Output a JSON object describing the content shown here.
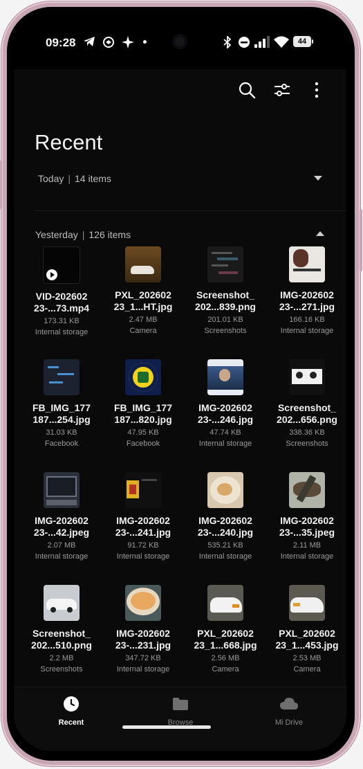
{
  "status_bar": {
    "time": "09:28",
    "battery": "44"
  },
  "header": {
    "title": "Recent"
  },
  "groups": {
    "today": {
      "label": "Today",
      "count": "14 items"
    },
    "yesterday": {
      "label": "Yesterday",
      "count": "126 items"
    }
  },
  "files": [
    {
      "name": "VID-202602\n23-...73.mp4",
      "size": "173.31 KB",
      "location": "Internal storage"
    },
    {
      "name": "PXL_202602\n23_1...HT.jpg",
      "size": "2.47 MB",
      "location": "Camera"
    },
    {
      "name": "Screenshot_\n202...839.png",
      "size": "201.01 KB",
      "location": "Screenshots"
    },
    {
      "name": "IMG-202602\n23-...271.jpg",
      "size": "166.16 KB",
      "location": "Internal storage"
    },
    {
      "name": "FB_IMG_177\n187...254.jpg",
      "size": "31.03 KB",
      "location": "Facebook"
    },
    {
      "name": "FB_IMG_177\n187...820.jpg",
      "size": "47.95 KB",
      "location": "Facebook"
    },
    {
      "name": "IMG-202602\n23-...246.jpg",
      "size": "47.74 KB",
      "location": "Internal storage"
    },
    {
      "name": "Screenshot_\n202...656.png",
      "size": "338.36 KB",
      "location": "Screenshots"
    },
    {
      "name": "IMG-202602\n23-...42.jpeg",
      "size": "2.07 MB",
      "location": "Internal storage"
    },
    {
      "name": "IMG-202602\n23-...241.jpg",
      "size": "91.72 KB",
      "location": "Internal storage"
    },
    {
      "name": "IMG-202602\n23-...240.jpg",
      "size": "535.21 KB",
      "location": "Internal storage"
    },
    {
      "name": "IMG-202602\n23-...35.jpeg",
      "size": "2.11 MB",
      "location": "Internal storage"
    },
    {
      "name": "Screenshot_\n202...510.png",
      "size": "2.2 MB",
      "location": "Screenshots"
    },
    {
      "name": "IMG-202602\n23-...231.jpg",
      "size": "347.72 KB",
      "location": "Internal storage"
    },
    {
      "name": "PXL_202602\n23_1...668.jpg",
      "size": "2.56 MB",
      "location": "Camera"
    },
    {
      "name": "PXL_202602\n23_1...453.jpg",
      "size": "2.53 MB",
      "location": "Camera"
    }
  ],
  "nav": {
    "recent": "Recent",
    "browse": "Browse",
    "drive": "Mi Drive"
  },
  "colors": {
    "background": "#0a0a0a",
    "frame": "#c9a6b4",
    "active_nav": "#ffffff",
    "inactive_nav": "#8a8a8a"
  },
  "icons": [
    "search-icon",
    "filter-icon",
    "more-icon",
    "clock-icon",
    "folder-icon",
    "cloud-icon",
    "play-icon"
  ]
}
